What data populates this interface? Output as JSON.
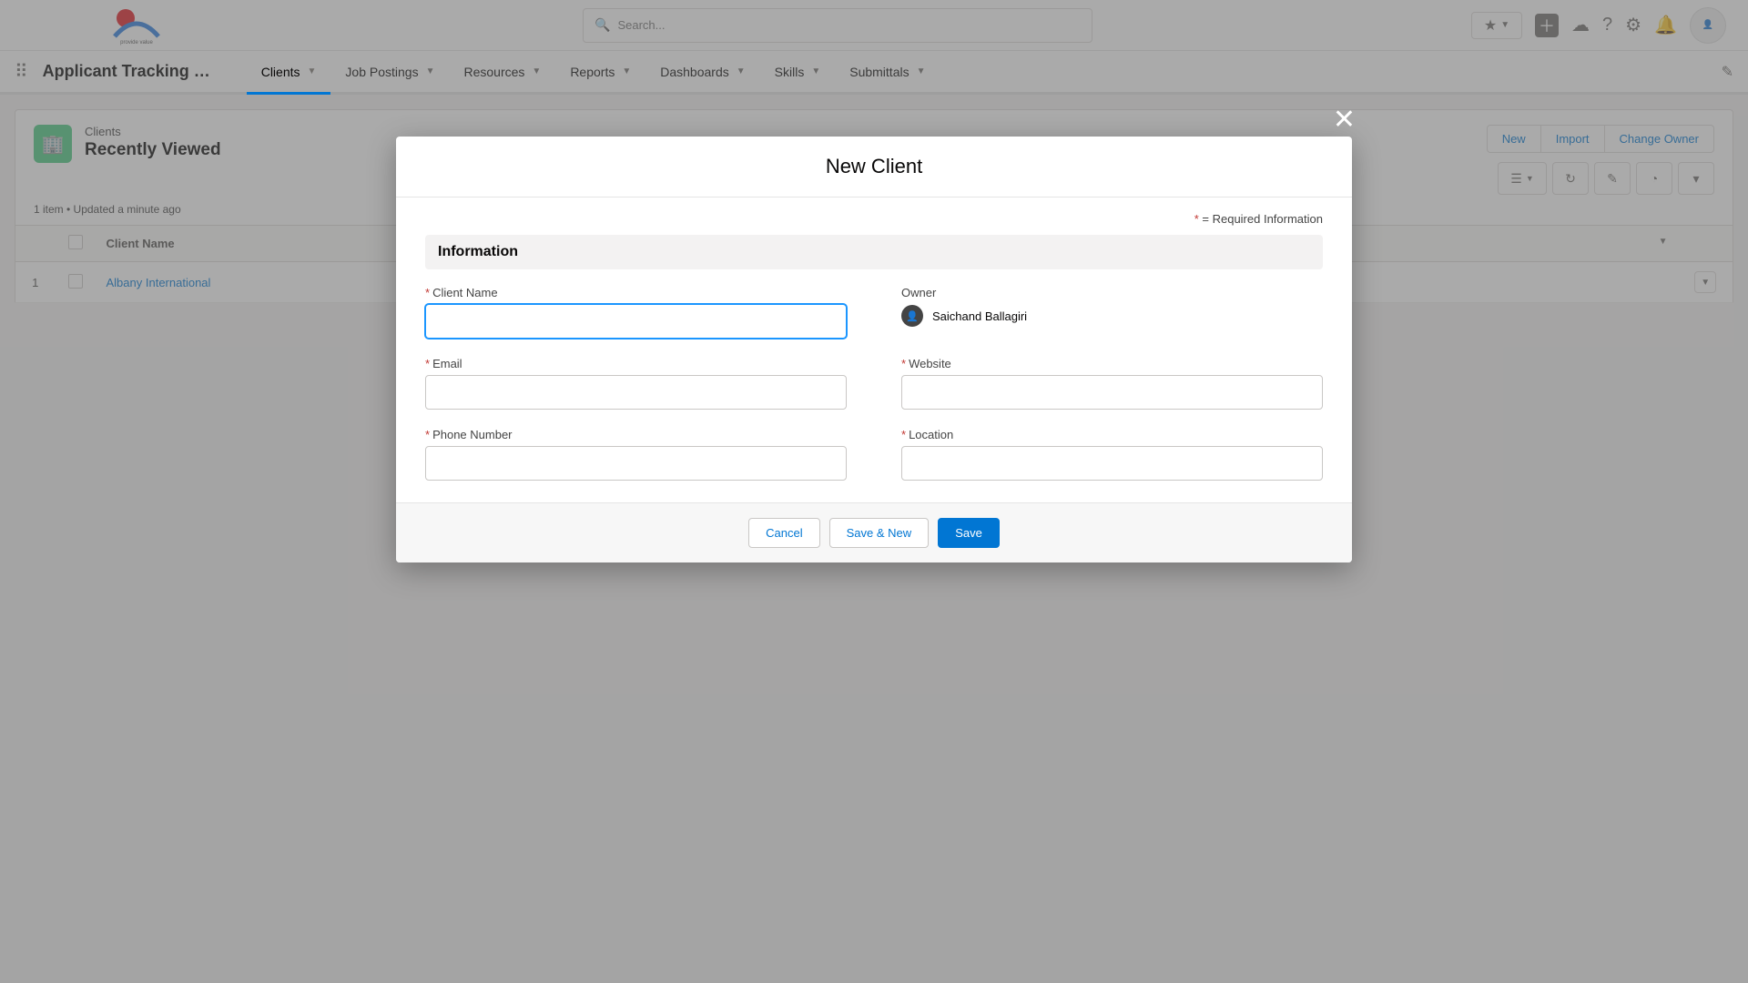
{
  "topbar": {
    "search_placeholder": "Search...",
    "logo_sub": "provide value"
  },
  "nav": {
    "app_name": "Applicant Tracking …",
    "tabs": [
      "Clients",
      "Job Postings",
      "Resources",
      "Reports",
      "Dashboards",
      "Skills",
      "Submittals"
    ]
  },
  "list": {
    "object_label": "Clients",
    "view_name": "Recently Viewed",
    "meta": "1 item • Updated a minute ago",
    "actions": {
      "new": "New",
      "import": "Import",
      "change_owner": "Change Owner"
    },
    "columns": {
      "client_name": "Client Name"
    },
    "rows": [
      {
        "num": "1",
        "client_name": "Albany International"
      }
    ]
  },
  "modal": {
    "title": "New Client",
    "required_info": "= Required Information",
    "section": "Information",
    "fields": {
      "client_name": "Client Name",
      "owner_label": "Owner",
      "owner_name": "Saichand Ballagiri",
      "email": "Email",
      "website": "Website",
      "phone": "Phone Number",
      "location": "Location"
    },
    "buttons": {
      "cancel": "Cancel",
      "save_new": "Save & New",
      "save": "Save"
    }
  }
}
